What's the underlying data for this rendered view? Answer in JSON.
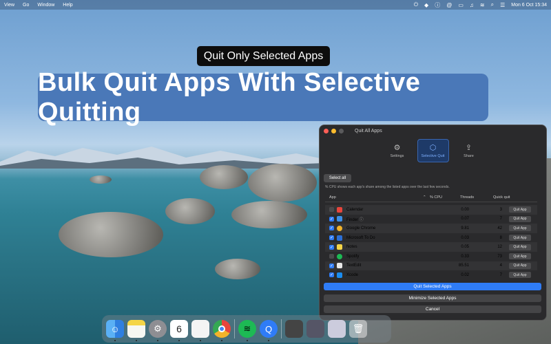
{
  "menubar": {
    "items": [
      "View",
      "Go",
      "Window",
      "Help"
    ],
    "clock": "Mon 6 Oct  15:34"
  },
  "banners": {
    "sub": "Quit Only Selected Apps",
    "main": "Bulk Quit Apps With Selective Quitting"
  },
  "window": {
    "title": "Quit All Apps",
    "tabs": [
      {
        "label": "Settings",
        "icon": "gear-icon"
      },
      {
        "label": "Selective Quit",
        "icon": "cube-icon"
      },
      {
        "label": "Share",
        "icon": "share-icon"
      }
    ],
    "select_all": "Select all",
    "note": "% CPU shows each app's share among the listed apps over the last few seconds.",
    "columns": {
      "app": "App",
      "cpu": "% CPU",
      "threads": "Threads",
      "quick": "Quick quit"
    },
    "rows": [
      {
        "name": "Calendar",
        "cpu": "0.00",
        "threads": "3",
        "checked": false,
        "color": "#e8453c"
      },
      {
        "name": "Finder",
        "cpu": "0.07",
        "threads": "7",
        "checked": true,
        "color": "#3d8fe6"
      },
      {
        "name": "Google Chrome",
        "cpu": "9.81",
        "threads": "42",
        "checked": true,
        "color": "#f2b32a"
      },
      {
        "name": "Microsoft To Do",
        "cpu": "0.03",
        "threads": "8",
        "checked": true,
        "color": "#2b6fd6"
      },
      {
        "name": "Notes",
        "cpu": "0.05",
        "threads": "12",
        "checked": true,
        "color": "#f5d547"
      },
      {
        "name": "Spotify",
        "cpu": "0.33",
        "threads": "73",
        "checked": false,
        "color": "#1db954"
      },
      {
        "name": "TextEdit",
        "cpu": "85.51",
        "threads": "4",
        "checked": true,
        "color": "#e8e8e8"
      },
      {
        "name": "Xcode",
        "cpu": "0.02",
        "threads": "7",
        "checked": true,
        "color": "#1a8cf0"
      }
    ],
    "quit_app_label": "Quit App",
    "buttons": {
      "quit_selected": "Quit Selected Apps",
      "minimize_selected": "Minimize Selected Apps",
      "cancel": "Cancel"
    }
  },
  "dock": {
    "calendar_day": "6"
  },
  "colors": {
    "accent": "#2f7cf6",
    "banner": "#4a78b8"
  }
}
